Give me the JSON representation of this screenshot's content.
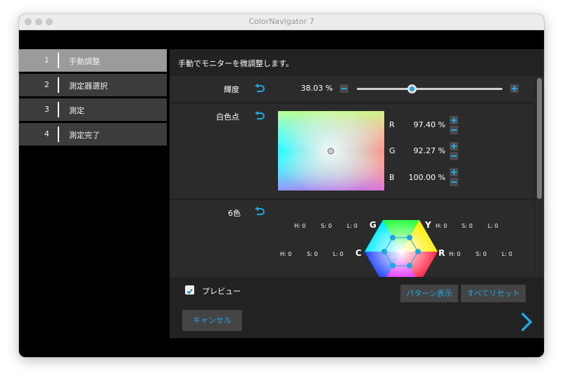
{
  "window": {
    "title": "ColorNavigator 7"
  },
  "sidebar": {
    "items": [
      {
        "num": "1",
        "label": "手動調整"
      },
      {
        "num": "2",
        "label": "測定器選択"
      },
      {
        "num": "3",
        "label": "測定"
      },
      {
        "num": "4",
        "label": "測定完了"
      }
    ]
  },
  "main": {
    "instruction": "手動でモニターを微調整します。",
    "brightness": {
      "label": "輝度",
      "value": "38.03 %",
      "level": 0.3803
    },
    "whitepoint": {
      "label": "白色点",
      "channels": [
        {
          "name": "R",
          "value": "97.40 %"
        },
        {
          "name": "G",
          "value": "92.27 %"
        },
        {
          "name": "B",
          "value": "100.00 %"
        }
      ]
    },
    "six_color": {
      "label": "6色",
      "g": {
        "letter": "G",
        "h": "H: 0",
        "s": "S: 0",
        "l": "L: 0"
      },
      "y": {
        "letter": "Y",
        "h": "H: 0",
        "s": "S: 0",
        "l": "L: 0"
      },
      "c": {
        "letter": "C",
        "h": "H: 0",
        "s": "S: 0",
        "l": "L: 0"
      },
      "r": {
        "letter": "R",
        "h": "H: 0",
        "s": "S: 0",
        "l": "L: 0"
      }
    },
    "preview": {
      "label": "プレビュー",
      "checked": true
    },
    "buttons": {
      "pattern": "パターン表示",
      "reset_all": "すべてリセット",
      "cancel": "キャンセル"
    }
  },
  "colors": {
    "accent": "#1ea7e1",
    "active_sidebar": "#9b9b9b",
    "sidebar": "#3c3c3c",
    "panel": "#2b2b2b"
  },
  "icons": {
    "undo": "undo-arrow-icon",
    "next": "chevron-right-icon",
    "check": "checkmark-icon"
  }
}
